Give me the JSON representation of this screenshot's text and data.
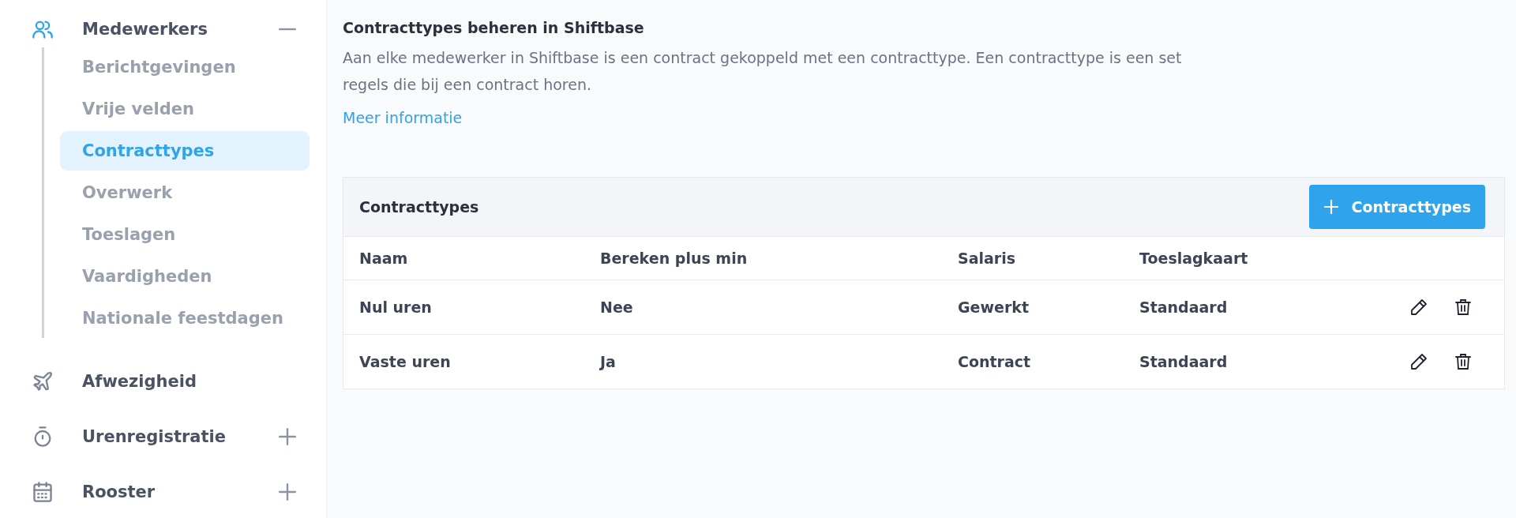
{
  "sidebar": {
    "items": [
      {
        "label": "Medewerkers",
        "expanded": true,
        "children": [
          {
            "label": "Berichtgevingen",
            "selected": false
          },
          {
            "label": "Vrije velden",
            "selected": false
          },
          {
            "label": "Contracttypes",
            "selected": true
          },
          {
            "label": "Overwerk",
            "selected": false
          },
          {
            "label": "Toeslagen",
            "selected": false
          },
          {
            "label": "Vaardigheden",
            "selected": false
          },
          {
            "label": "Nationale feestdagen",
            "selected": false
          }
        ]
      },
      {
        "label": "Afwezigheid"
      },
      {
        "label": "Urenregistratie",
        "expanded": false
      },
      {
        "label": "Rooster",
        "expanded": false
      }
    ]
  },
  "intro": {
    "title": "Contracttypes beheren in Shiftbase",
    "text": "Aan elke medewerker in Shiftbase is een contract gekoppeld met een contracttype. Een contracttype is een set regels die bij een contract horen.",
    "link": "Meer informatie"
  },
  "table": {
    "title": "Contracttypes",
    "add_button": "Contracttypes",
    "columns": [
      "Naam",
      "Bereken plus min",
      "Salaris",
      "Toeslagkaart"
    ],
    "rows": [
      [
        "Nul uren",
        "Nee",
        "Gewerkt",
        "Standaard"
      ],
      [
        "Vaste uren",
        "Ja",
        "Contract",
        "Standaard"
      ]
    ]
  }
}
